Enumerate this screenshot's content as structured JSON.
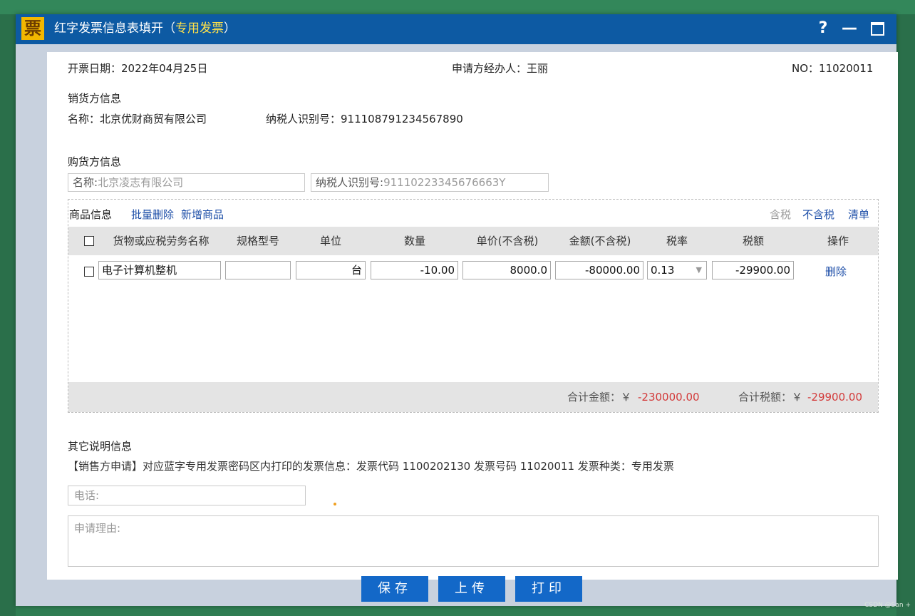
{
  "window": {
    "title_main": "红字发票信息表填开（",
    "title_highlight": "专用发票",
    "title_end": "）",
    "help_label": "?",
    "min_label": "—"
  },
  "header": {
    "date": "开票日期：2022年04月25日",
    "handler": "申请方经办人：王丽",
    "no": "NO：11020011"
  },
  "seller": {
    "section_title": "销货方信息",
    "name": "名称：北京优财商贸有限公司",
    "tax_id": "纳税人识别号：911108791234567890"
  },
  "buyer": {
    "section_title": "购货方信息",
    "name_label": "名称:",
    "name_value": "北京凌志有限公司",
    "tax_label": "纳税人识别号:",
    "tax_value": "91110223345676663Y"
  },
  "goods": {
    "title": "商品信息",
    "batch_delete": "批量删除",
    "add_item": "新增商品",
    "tax_incl": "含税",
    "tax_excl": "不含税",
    "list": "清单",
    "columns": [
      "货物或应税劳务名称",
      "规格型号",
      "单位",
      "数量",
      "单价(不含税)",
      "金额(不含税)",
      "税率",
      "税额",
      "操作"
    ],
    "rows": [
      {
        "name": "电子计算机整机",
        "spec": "",
        "unit": "台",
        "qty": "-10.00",
        "price": "8000.0",
        "amount": "-80000.00",
        "rate": "0.13",
        "tax": "-29900.00",
        "action": "删除"
      }
    ],
    "total_amount_label": "合计金额：￥",
    "total_amount": "-230000.00",
    "total_tax_label": "合计税额：￥",
    "total_tax": "-29900.00"
  },
  "other": {
    "section_title": "其它说明信息",
    "note": "【销售方申请】对应蓝字专用发票密码区内打印的发票信息：发票代码 1100202130 发票号码 11020011 发票种类：专用发票",
    "phone_placeholder": "电话:",
    "reason_placeholder": "申请理由:"
  },
  "buttons": {
    "save": "保存",
    "upload": "上传",
    "print": "打印"
  },
  "watermark": "CSDN @San +"
}
